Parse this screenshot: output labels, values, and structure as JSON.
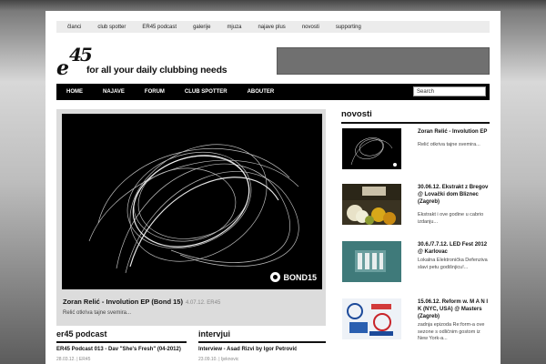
{
  "top_nav": [
    "članci",
    "club spotter",
    "ER45 podcast",
    "galerije",
    "mjuza",
    "najave plus",
    "novosti",
    "supporting"
  ],
  "logo": {
    "mark_e": "e",
    "mark_num": "45",
    "tagline": "for all your daily clubbing needs"
  },
  "main_nav": [
    "HOME",
    "NAJAVE",
    "FORUM",
    "CLUB SPOTTER",
    "ABOUTER"
  ],
  "search": {
    "value": "Search"
  },
  "feature": {
    "badge": "BOND15",
    "title": "Zoran Relić - Involution EP (Bond 15)",
    "date": "4.07.12. ER45",
    "excerpt": "Relić otkriva tajne svemira..."
  },
  "podcast": {
    "heading": "er45 podcast",
    "item_title": "ER45 Podcast 013 - Dav \"She's Fresh\" (04-2012)",
    "item_meta": "28.03.12. | ER45"
  },
  "intervju": {
    "heading": "intervjui",
    "item_title": "Interview - Asad Rizvi by Igor Petrović",
    "item_meta": "23.09.10. | Ijeknovic"
  },
  "news": {
    "heading": "novosti",
    "items": [
      {
        "title": "Zoran Relić - Involution EP",
        "text": "Relić otkriva tajne svemira..."
      },
      {
        "title": "30.06.12. Ekstrakt z Bregov @ Lovački dom Bliznec (Zagreb)",
        "text": "Ekstrakt i ove godine u cabrio izdanju..."
      },
      {
        "title": "30.6./7.7.12. LED Fest 2012 @ Karlovac",
        "text": "Lokalna Elektronička Defenziva slavi petu godišnjicu!..."
      },
      {
        "title": "15.06.12. Reform w. M A N I K (NYC, USA) @ Masters (Zagreb)",
        "text": "zadnja epizoda Re:form-a ove sezone s odličnim gostom iz New York-a..."
      }
    ]
  },
  "colors": {
    "nav_bg": "#000000",
    "topnav_bg": "#ececec",
    "feature_bg": "#dcdcdc"
  }
}
